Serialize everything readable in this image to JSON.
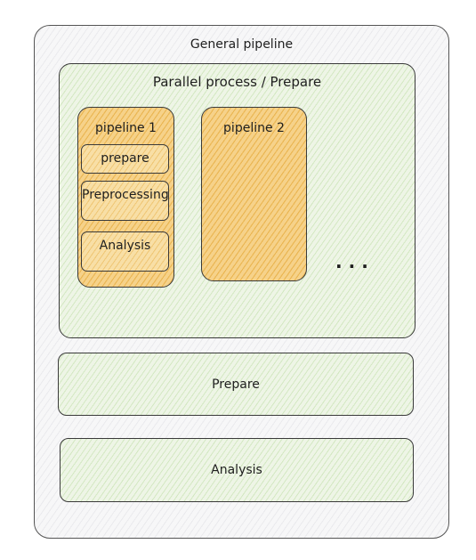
{
  "general_pipeline": {
    "title": "General pipeline"
  },
  "parallel_block": {
    "title": "Parallel process / Prepare",
    "pipelines": [
      {
        "title": "pipeline 1",
        "steps": [
          "prepare",
          "Preprocessing",
          "Analysis"
        ]
      },
      {
        "title": "pipeline 2",
        "steps": []
      }
    ],
    "more_indicator": "..."
  },
  "prepare_block": {
    "title": "Prepare"
  },
  "analysis_block": {
    "title": "Analysis"
  },
  "colors": {
    "container_fill": "#f7f7f8",
    "stage_fill": "#eef5e6",
    "pipeline_fill": "#f6d28a",
    "stroke": "#3a3a3a"
  }
}
